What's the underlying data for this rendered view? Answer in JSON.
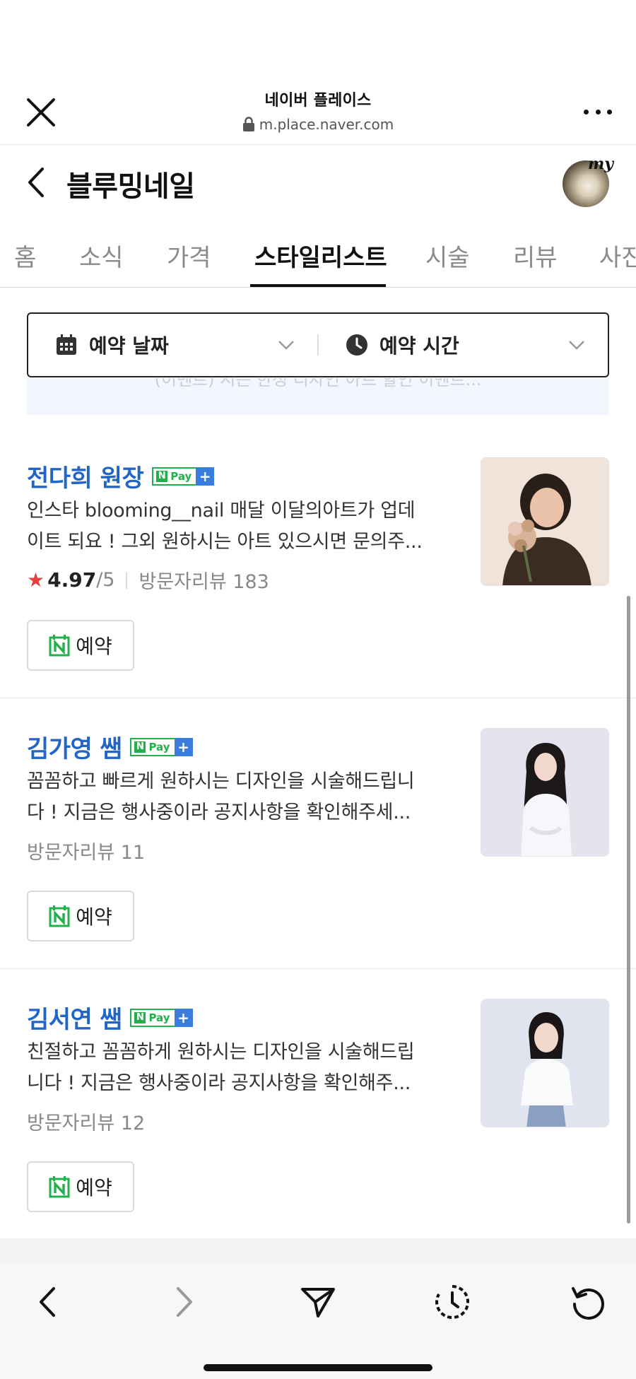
{
  "browser": {
    "site_title": "네이버 플레이스",
    "url": "m.place.naver.com"
  },
  "header": {
    "title": "블루밍네일",
    "avatar_label": "my"
  },
  "tabs": [
    {
      "label": "홈"
    },
    {
      "label": "소식"
    },
    {
      "label": "가격"
    },
    {
      "label": "스타일리스트",
      "active": true
    },
    {
      "label": "시술"
    },
    {
      "label": "리뷰"
    },
    {
      "label": "사진"
    }
  ],
  "filters": {
    "date_label": "예약 날짜",
    "time_label": "예약 시간"
  },
  "banner_text": "(이벤트) 시즌 한정 디자인 아트 할인 이벤트...",
  "npay_badge": {
    "n": "N",
    "pay": "Pay",
    "plus": "+"
  },
  "stylists": [
    {
      "name": "전다희 원장",
      "desc_line1": "인스타 blooming__nail 매달 이달의아트가 업데",
      "desc_line2": "이트 되요 ! 그외 원하시는 아트 있으시면 문의주...",
      "rating": "4.97",
      "rating_max": "/5",
      "reviews": "방문자리뷰 183",
      "reserve_label": "예약"
    },
    {
      "name": "김가영 쌤",
      "desc_line1": "꼼꼼하고 빠르게 원하시는 디자인을 시술해드립니",
      "desc_line2": "다 ! 지금은 행사중이라 공지사항을 확인해주세...",
      "reviews": "방문자리뷰 11",
      "reserve_label": "예약"
    },
    {
      "name": "김서연 쌤",
      "desc_line1": "친절하고 꼼꼼하게 원하시는 디자인을 시술해드립",
      "desc_line2": "니다 ! 지금은 행사중이라 공지사항을 확인해주...",
      "reviews": "방문자리뷰 12",
      "reserve_label": "예약"
    }
  ],
  "colors": {
    "link_blue": "#2166c6",
    "npay_green": "#22b04b",
    "star_red": "#e0433f"
  },
  "icons": {
    "browser": [
      "close-icon",
      "lock-icon",
      "more-icon"
    ],
    "toolbar": [
      "back-arrow-icon",
      "forward-arrow-icon",
      "share-send-icon",
      "history-clock-icon",
      "reload-icon"
    ]
  }
}
